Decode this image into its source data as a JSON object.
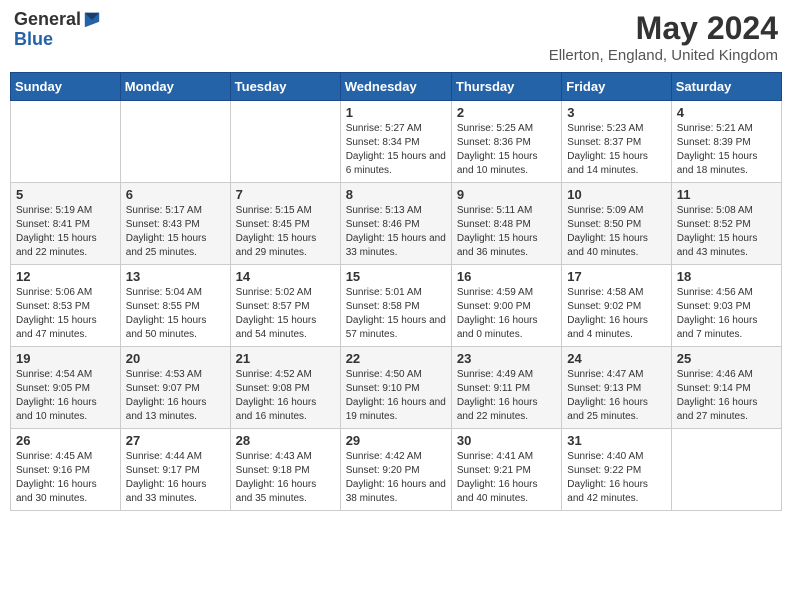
{
  "header": {
    "logo_general": "General",
    "logo_blue": "Blue",
    "month_year": "May 2024",
    "location": "Ellerton, England, United Kingdom"
  },
  "days_of_week": [
    "Sunday",
    "Monday",
    "Tuesday",
    "Wednesday",
    "Thursday",
    "Friday",
    "Saturday"
  ],
  "weeks": [
    [
      {
        "day": "",
        "info": ""
      },
      {
        "day": "",
        "info": ""
      },
      {
        "day": "",
        "info": ""
      },
      {
        "day": "1",
        "info": "Sunrise: 5:27 AM\nSunset: 8:34 PM\nDaylight: 15 hours\nand 6 minutes."
      },
      {
        "day": "2",
        "info": "Sunrise: 5:25 AM\nSunset: 8:36 PM\nDaylight: 15 hours\nand 10 minutes."
      },
      {
        "day": "3",
        "info": "Sunrise: 5:23 AM\nSunset: 8:37 PM\nDaylight: 15 hours\nand 14 minutes."
      },
      {
        "day": "4",
        "info": "Sunrise: 5:21 AM\nSunset: 8:39 PM\nDaylight: 15 hours\nand 18 minutes."
      }
    ],
    [
      {
        "day": "5",
        "info": "Sunrise: 5:19 AM\nSunset: 8:41 PM\nDaylight: 15 hours\nand 22 minutes."
      },
      {
        "day": "6",
        "info": "Sunrise: 5:17 AM\nSunset: 8:43 PM\nDaylight: 15 hours\nand 25 minutes."
      },
      {
        "day": "7",
        "info": "Sunrise: 5:15 AM\nSunset: 8:45 PM\nDaylight: 15 hours\nand 29 minutes."
      },
      {
        "day": "8",
        "info": "Sunrise: 5:13 AM\nSunset: 8:46 PM\nDaylight: 15 hours\nand 33 minutes."
      },
      {
        "day": "9",
        "info": "Sunrise: 5:11 AM\nSunset: 8:48 PM\nDaylight: 15 hours\nand 36 minutes."
      },
      {
        "day": "10",
        "info": "Sunrise: 5:09 AM\nSunset: 8:50 PM\nDaylight: 15 hours\nand 40 minutes."
      },
      {
        "day": "11",
        "info": "Sunrise: 5:08 AM\nSunset: 8:52 PM\nDaylight: 15 hours\nand 43 minutes."
      }
    ],
    [
      {
        "day": "12",
        "info": "Sunrise: 5:06 AM\nSunset: 8:53 PM\nDaylight: 15 hours\nand 47 minutes."
      },
      {
        "day": "13",
        "info": "Sunrise: 5:04 AM\nSunset: 8:55 PM\nDaylight: 15 hours\nand 50 minutes."
      },
      {
        "day": "14",
        "info": "Sunrise: 5:02 AM\nSunset: 8:57 PM\nDaylight: 15 hours\nand 54 minutes."
      },
      {
        "day": "15",
        "info": "Sunrise: 5:01 AM\nSunset: 8:58 PM\nDaylight: 15 hours\nand 57 minutes."
      },
      {
        "day": "16",
        "info": "Sunrise: 4:59 AM\nSunset: 9:00 PM\nDaylight: 16 hours\nand 0 minutes."
      },
      {
        "day": "17",
        "info": "Sunrise: 4:58 AM\nSunset: 9:02 PM\nDaylight: 16 hours\nand 4 minutes."
      },
      {
        "day": "18",
        "info": "Sunrise: 4:56 AM\nSunset: 9:03 PM\nDaylight: 16 hours\nand 7 minutes."
      }
    ],
    [
      {
        "day": "19",
        "info": "Sunrise: 4:54 AM\nSunset: 9:05 PM\nDaylight: 16 hours\nand 10 minutes."
      },
      {
        "day": "20",
        "info": "Sunrise: 4:53 AM\nSunset: 9:07 PM\nDaylight: 16 hours\nand 13 minutes."
      },
      {
        "day": "21",
        "info": "Sunrise: 4:52 AM\nSunset: 9:08 PM\nDaylight: 16 hours\nand 16 minutes."
      },
      {
        "day": "22",
        "info": "Sunrise: 4:50 AM\nSunset: 9:10 PM\nDaylight: 16 hours\nand 19 minutes."
      },
      {
        "day": "23",
        "info": "Sunrise: 4:49 AM\nSunset: 9:11 PM\nDaylight: 16 hours\nand 22 minutes."
      },
      {
        "day": "24",
        "info": "Sunrise: 4:47 AM\nSunset: 9:13 PM\nDaylight: 16 hours\nand 25 minutes."
      },
      {
        "day": "25",
        "info": "Sunrise: 4:46 AM\nSunset: 9:14 PM\nDaylight: 16 hours\nand 27 minutes."
      }
    ],
    [
      {
        "day": "26",
        "info": "Sunrise: 4:45 AM\nSunset: 9:16 PM\nDaylight: 16 hours\nand 30 minutes."
      },
      {
        "day": "27",
        "info": "Sunrise: 4:44 AM\nSunset: 9:17 PM\nDaylight: 16 hours\nand 33 minutes."
      },
      {
        "day": "28",
        "info": "Sunrise: 4:43 AM\nSunset: 9:18 PM\nDaylight: 16 hours\nand 35 minutes."
      },
      {
        "day": "29",
        "info": "Sunrise: 4:42 AM\nSunset: 9:20 PM\nDaylight: 16 hours\nand 38 minutes."
      },
      {
        "day": "30",
        "info": "Sunrise: 4:41 AM\nSunset: 9:21 PM\nDaylight: 16 hours\nand 40 minutes."
      },
      {
        "day": "31",
        "info": "Sunrise: 4:40 AM\nSunset: 9:22 PM\nDaylight: 16 hours\nand 42 minutes."
      },
      {
        "day": "",
        "info": ""
      }
    ]
  ]
}
